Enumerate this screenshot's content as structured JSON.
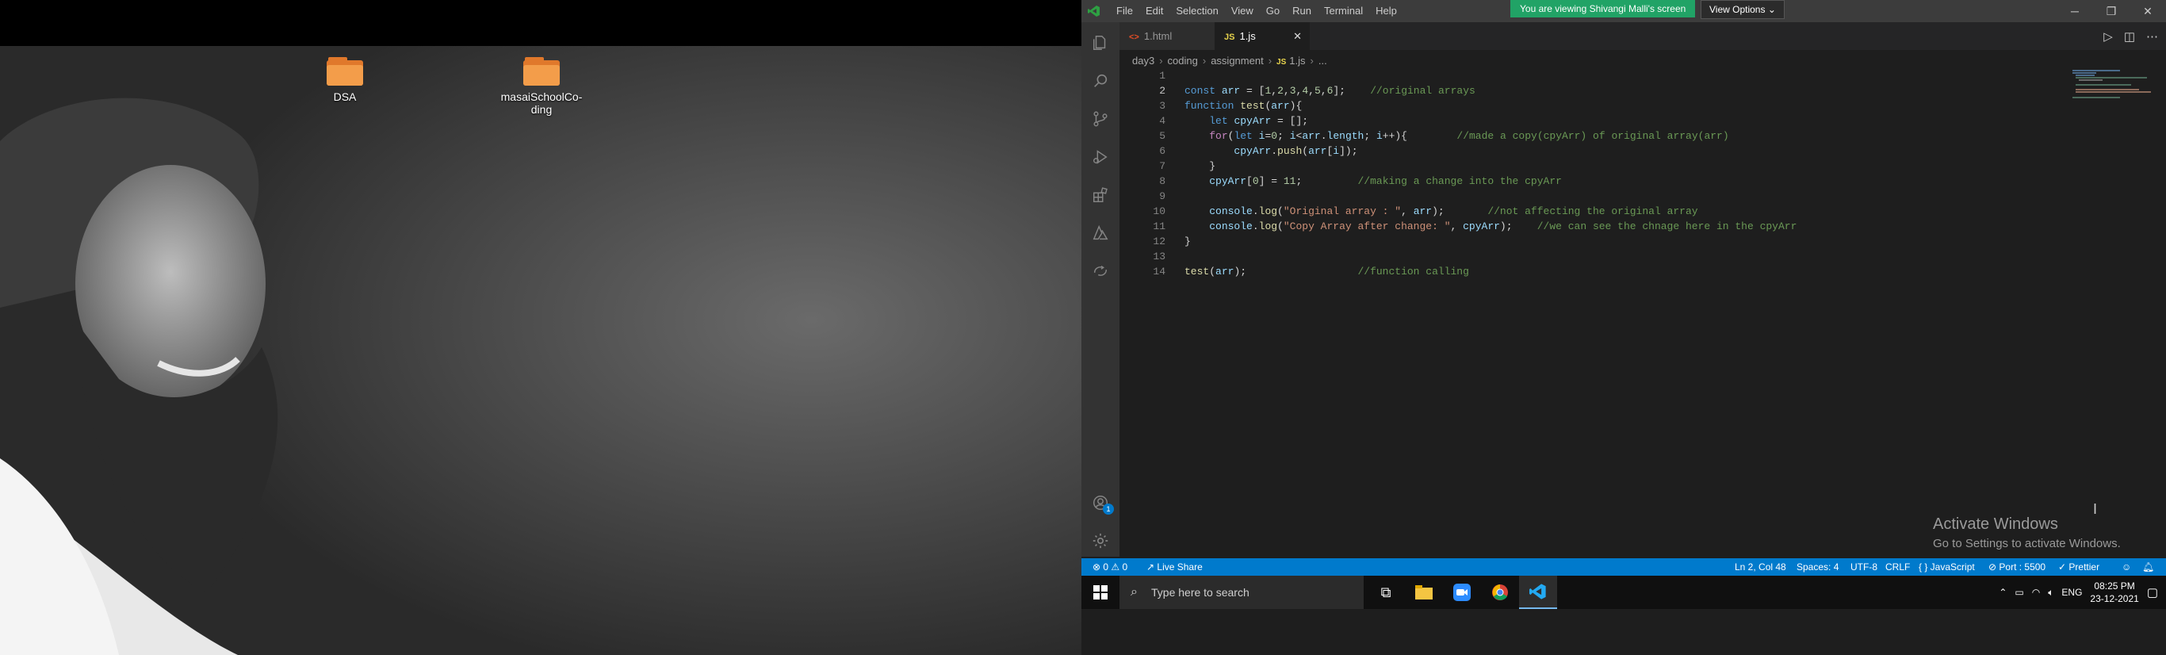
{
  "desktop": {
    "icons": [
      {
        "label": "DSA"
      },
      {
        "label": "masaiSchoolCo-ding"
      }
    ]
  },
  "vscode": {
    "menu": [
      "File",
      "Edit",
      "Selection",
      "View",
      "Go",
      "Run",
      "Terminal",
      "Help"
    ],
    "share_banner": "You are viewing Shivangi Malli's screen",
    "view_options": "View Options",
    "tabs": [
      {
        "icon": "<>",
        "label": "1.html"
      },
      {
        "icon": "JS",
        "label": "1.js"
      }
    ],
    "breadcrumb": [
      "day3",
      "coding",
      "assignment",
      "1.js",
      "..."
    ],
    "breadcrumb_file_icon": "JS",
    "code": [
      {
        "n": "1",
        "parts": []
      },
      {
        "n": "2",
        "parts": [
          [
            "kw",
            "const "
          ],
          [
            "v",
            "arr"
          ],
          [
            "p",
            " = ["
          ],
          [
            "num",
            "1"
          ],
          [
            "p",
            ","
          ],
          [
            "num",
            "2"
          ],
          [
            "p",
            ","
          ],
          [
            "num",
            "3"
          ],
          [
            "p",
            ","
          ],
          [
            "num",
            "4"
          ],
          [
            "p",
            ","
          ],
          [
            "num",
            "5"
          ],
          [
            "p",
            ","
          ],
          [
            "num",
            "6"
          ],
          [
            "p",
            "];    "
          ],
          [
            "cm",
            "//original arrays"
          ]
        ]
      },
      {
        "n": "3",
        "parts": [
          [
            "kw",
            "function "
          ],
          [
            "fn",
            "test"
          ],
          [
            "p",
            "("
          ],
          [
            "v",
            "arr"
          ],
          [
            "p",
            "){"
          ]
        ]
      },
      {
        "n": "4",
        "parts": [
          [
            "p",
            "    "
          ],
          [
            "kw",
            "let "
          ],
          [
            "v",
            "cpyArr"
          ],
          [
            "p",
            " = [];"
          ]
        ]
      },
      {
        "n": "5",
        "parts": [
          [
            "p",
            "    "
          ],
          [
            "kw2",
            "for"
          ],
          [
            "p",
            "("
          ],
          [
            "kw",
            "let "
          ],
          [
            "v",
            "i"
          ],
          [
            "p",
            "="
          ],
          [
            "num",
            "0"
          ],
          [
            "p",
            "; "
          ],
          [
            "v",
            "i"
          ],
          [
            "p",
            "<"
          ],
          [
            "v",
            "arr"
          ],
          [
            "p",
            "."
          ],
          [
            "v",
            "length"
          ],
          [
            "p",
            "; "
          ],
          [
            "v",
            "i"
          ],
          [
            "p",
            "++){        "
          ],
          [
            "cm",
            "//made a copy(cpyArr) of original array(arr)"
          ]
        ]
      },
      {
        "n": "6",
        "parts": [
          [
            "p",
            "        "
          ],
          [
            "v",
            "cpyArr"
          ],
          [
            "p",
            "."
          ],
          [
            "fn",
            "push"
          ],
          [
            "p",
            "("
          ],
          [
            "v",
            "arr"
          ],
          [
            "p",
            "["
          ],
          [
            "v",
            "i"
          ],
          [
            "p",
            "]);"
          ]
        ]
      },
      {
        "n": "7",
        "parts": [
          [
            "p",
            "    }"
          ]
        ]
      },
      {
        "n": "8",
        "parts": [
          [
            "p",
            "    "
          ],
          [
            "v",
            "cpyArr"
          ],
          [
            "p",
            "["
          ],
          [
            "num",
            "0"
          ],
          [
            "p",
            "] = "
          ],
          [
            "num",
            "11"
          ],
          [
            "p",
            ";         "
          ],
          [
            "cm",
            "//making a change into the cpyArr"
          ]
        ]
      },
      {
        "n": "9",
        "parts": []
      },
      {
        "n": "10",
        "parts": [
          [
            "p",
            "    "
          ],
          [
            "v",
            "console"
          ],
          [
            "p",
            "."
          ],
          [
            "fn",
            "log"
          ],
          [
            "p",
            "("
          ],
          [
            "str",
            "\"Original array : \""
          ],
          [
            "p",
            ", "
          ],
          [
            "v",
            "arr"
          ],
          [
            "p",
            ");       "
          ],
          [
            "cm",
            "//not affecting the original array"
          ]
        ]
      },
      {
        "n": "11",
        "parts": [
          [
            "p",
            "    "
          ],
          [
            "v",
            "console"
          ],
          [
            "p",
            "."
          ],
          [
            "fn",
            "log"
          ],
          [
            "p",
            "("
          ],
          [
            "str",
            "\"Copy Array after change: \""
          ],
          [
            "p",
            ", "
          ],
          [
            "v",
            "cpyArr"
          ],
          [
            "p",
            ");    "
          ],
          [
            "cm",
            "//we can see the chnage here in the cpyArr"
          ]
        ]
      },
      {
        "n": "12",
        "parts": [
          [
            "p",
            "}"
          ]
        ]
      },
      {
        "n": "13",
        "parts": []
      },
      {
        "n": "14",
        "parts": [
          [
            "fn",
            "test"
          ],
          [
            "p",
            "("
          ],
          [
            "v",
            "arr"
          ],
          [
            "p",
            ");                  "
          ],
          [
            "cm",
            "//function calling"
          ]
        ]
      }
    ],
    "current_line": "2",
    "activate": {
      "title": "Activate Windows",
      "subtitle": "Go to Settings to activate Windows."
    },
    "accounts_badge": "1",
    "status": {
      "problems": "⊗ 0 ⚠ 0",
      "live_share": "Live Share",
      "position": "Ln 2, Col 48",
      "spaces": "Spaces: 4",
      "encoding": "UTF-8",
      "eol": "CRLF",
      "language": "{ } JavaScript",
      "port": "⊘ Port : 5500",
      "prettier": "✓ Prettier"
    }
  },
  "taskbar": {
    "search_placeholder": "Type here to search",
    "lang": "ENG",
    "time": "08:25 PM",
    "date": "23-12-2021"
  },
  "colors": {
    "accent_blue": "#007acc",
    "share_green": "#21a366",
    "folder_orange": "#f39d4a"
  }
}
